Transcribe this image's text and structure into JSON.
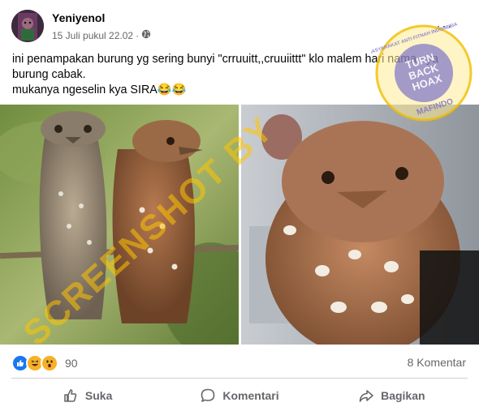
{
  "post": {
    "author": "Yeniyenol",
    "timestamp": "15 Juli pukul 22.02",
    "privacy_separator": "·",
    "text_lines": [
      "ini penampakan burung yg sering bunyi \"crruuitt,,cruuiittt\" klo malem hari nama nya",
      "burung cabak.",
      "mukanya ngeselin kya SIRA😂😂"
    ]
  },
  "reactions": {
    "count": "90",
    "icons": [
      "like-icon",
      "haha-icon",
      "wow-icon"
    ]
  },
  "comments_label": "8 Komentar",
  "actions": {
    "like": "Suka",
    "comment": "Komentari",
    "share": "Bagikan"
  },
  "watermark": {
    "text": "SCREENSHOT BY",
    "stamp_lines": [
      "TURN",
      "BACK",
      "HOAX"
    ],
    "stamp_ring": "MASYARAKAT ANTI FITNAH INDONESIA",
    "stamp_brand": "MAFINDO"
  },
  "colors": {
    "secondary_text": "#65676b",
    "like_blue": "#1877f2",
    "reaction_yellow": "#f7b125",
    "watermark_yellow": "#ffc400"
  }
}
